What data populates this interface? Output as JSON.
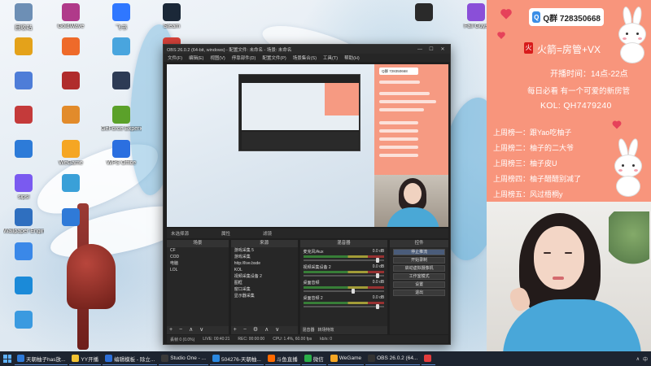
{
  "desktop": {
    "icons": [
      {
        "label": "回收站",
        "color": "#6d8fb5"
      },
      {
        "label": "GoldWave",
        "color": "#b03a8a"
      },
      {
        "label": "飞书",
        "color": "#2f77ff"
      },
      {
        "label": "Steam",
        "color": "#1b2838"
      },
      {
        "label": "",
        "color": "#2a2a2a"
      },
      {
        "label": "Fall Guys",
        "color": "#8a4fd8"
      },
      {
        "label": "",
        "color": "#e4a21a"
      },
      {
        "label": "",
        "color": "#ee6a2a"
      },
      {
        "label": "",
        "color": "#49a5de"
      },
      {
        "label": "",
        "color": "#d8423a"
      },
      {
        "label": "",
        "color": "#4e7dd8"
      },
      {
        "label": "",
        "color": "#b02c2c"
      },
      {
        "label": "",
        "color": "#2d3b55"
      },
      {
        "label": "",
        "color": "#c43a3a"
      },
      {
        "label": "",
        "color": "#e28b2b"
      },
      {
        "label": "GeForce Experience",
        "color": "#5ba12a"
      },
      {
        "label": "",
        "color": "#2d7bd8"
      },
      {
        "label": "WeGame",
        "color": "#f5a623"
      },
      {
        "label": "WPS Office",
        "color": "#2b6fe0"
      },
      {
        "label": "sipsl",
        "color": "#7a5af0"
      },
      {
        "label": "",
        "color": "#3aa0d8"
      },
      {
        "label": "Wallpaper Engine",
        "color": "#2f6fbf"
      },
      {
        "label": "",
        "color": "#2f7ad8"
      },
      {
        "label": "",
        "color": "#3a88e8"
      },
      {
        "label": "",
        "color": "#1b8ad8"
      },
      {
        "label": "",
        "color": "#3a9ae0"
      }
    ]
  },
  "obs": {
    "title": "OBS 26.0.2 (64-bit, windows) - 配置文件: 未命名 - 场景: 未命名",
    "window_buttons": [
      "—",
      "☐",
      "✕"
    ],
    "menu": [
      "文件(F)",
      "编辑(E)",
      "视图(V)",
      "停靠部件(D)",
      "配置文件(P)",
      "场景集合(S)",
      "工具(T)",
      "帮助(H)"
    ],
    "source_bar": {
      "label": "未选择源",
      "props": "属性",
      "filters": "滤镜"
    },
    "scenes": {
      "header": "场景",
      "items": [
        "CF",
        "COD",
        "电脑",
        "LOL"
      ],
      "footer": "+ − ∧ ∨"
    },
    "sources": {
      "header": "来源",
      "items": [
        "游戏采集 5",
        "游戏采集",
        "http://live.bsde",
        "KOL",
        "视频采集设备 2",
        "图框",
        "窗口采集",
        "显示器采集"
      ],
      "footer": "+ − ⚙ ∧ ∨"
    },
    "mixer": {
      "header": "混音器",
      "channels": [
        {
          "name": "麦克风/Aux",
          "db": "0.0 dB"
        },
        {
          "name": "视频采集设备 2",
          "db": "0.0 dB"
        },
        {
          "name": "桌面音频",
          "db": "0.0 dB"
        },
        {
          "name": "桌面音频 2",
          "db": "0.0 dB"
        }
      ],
      "tabs": [
        "混音器",
        "转场特效"
      ]
    },
    "controls": {
      "header": "控件",
      "buttons": [
        "停止推流",
        "开始录制",
        "启动虚拟摄像机",
        "工作室模式",
        "设置",
        "退出"
      ]
    },
    "status": {
      "drop": "丢帧 0 (0.0%)",
      "live": "LIVE: 00:40:21",
      "rec": "REC: 00:00:00",
      "cpu": "CPU: 1.4%, 60.00 fps",
      "kbps": "kb/s: 0"
    }
  },
  "promo": {
    "qq": "Q群 728350668",
    "fire_line": "火箭=房管+VX",
    "fire_icon": "火",
    "hours": "开播时间：14点-22点",
    "daily": "每日必看  有一个可爱的新房管",
    "kol": "KOL: QH7479240",
    "sponsors": [
      "上周榜一：跟Yao吃柚子",
      "上周榜二：柚子的二大爷",
      "上周榜三：柚子皮U",
      "上周榜四：柚子醋醋别减了",
      "上周榜五：风过梧桐y"
    ]
  },
  "taskbar": {
    "tasks": [
      {
        "label": "天朝柚子has放...",
        "color": "#2f7ad8"
      },
      {
        "label": "YY开播",
        "color": "#f1c232"
      },
      {
        "label": "编辑模板 - 除立...",
        "color": "#2d6fd8"
      },
      {
        "label": "Studio One - ...",
        "color": "#3a3a3a"
      },
      {
        "label": "504276-天朝柚...",
        "color": "#2a88e0"
      },
      {
        "label": "斗鱼直播",
        "color": "#ff6a00"
      },
      {
        "label": "微信",
        "color": "#2aae49"
      },
      {
        "label": "WeGame",
        "color": "#f5a623"
      },
      {
        "label": "OBS 26.0.2 (64...",
        "color": "#333333"
      },
      {
        "label": "",
        "color": "#e23c3c"
      }
    ],
    "tray": [
      "∧",
      "中"
    ]
  }
}
